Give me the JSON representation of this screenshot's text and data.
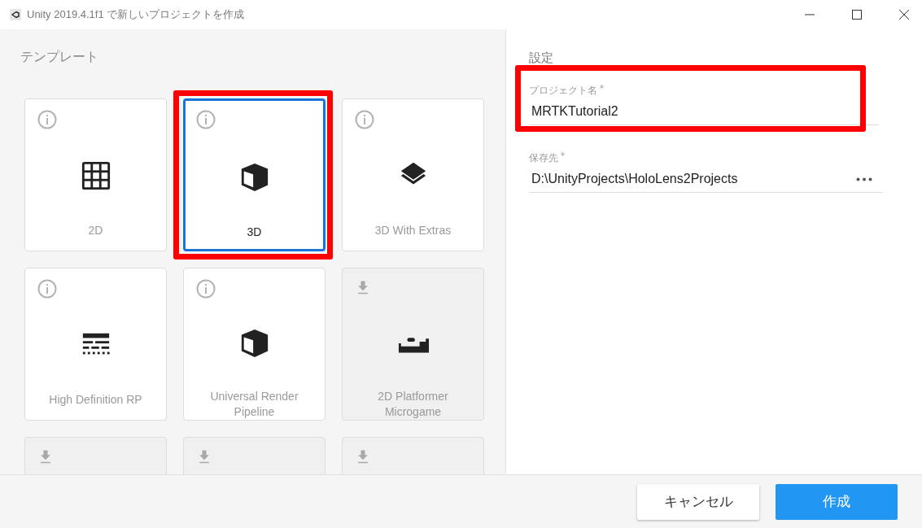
{
  "window": {
    "title": "Unity 2019.4.1f1 で新しいプロジェクトを作成"
  },
  "templates": {
    "heading": "テンプレート",
    "items": [
      {
        "label": "2D",
        "kind": "grid",
        "downloaded": true,
        "selected": false,
        "highlighted": false
      },
      {
        "label": "3D",
        "kind": "cube",
        "downloaded": true,
        "selected": true,
        "highlighted": true
      },
      {
        "label": "3D With Extras",
        "kind": "layers",
        "downloaded": true,
        "selected": false,
        "highlighted": false
      },
      {
        "label": "High Definition RP",
        "kind": "lines",
        "downloaded": true,
        "selected": false,
        "highlighted": false
      },
      {
        "label": "Universal Render Pipeline",
        "kind": "cube",
        "downloaded": true,
        "selected": false,
        "highlighted": false
      },
      {
        "label": "2D Platformer Microgame",
        "kind": "platform",
        "downloaded": false,
        "selected": false,
        "highlighted": false
      },
      {
        "downloaded": false,
        "selected": false,
        "highlighted": false
      },
      {
        "downloaded": false,
        "selected": false,
        "highlighted": false
      },
      {
        "downloaded": false,
        "selected": false,
        "highlighted": false
      }
    ]
  },
  "settings": {
    "heading": "設定",
    "fields": [
      {
        "label": "プロジェクト名",
        "required_mark": "*",
        "value": "MRTKTutorial2",
        "highlighted": true,
        "kind": "text"
      },
      {
        "label": "保存先",
        "required_mark": "*",
        "value": "D:\\UnityProjects\\HoloLens2Projects",
        "highlighted": false,
        "kind": "path"
      }
    ]
  },
  "buttons": [
    {
      "label": "キャンセル",
      "kind": "secondary"
    },
    {
      "label": "作成",
      "kind": "primary"
    }
  ]
}
